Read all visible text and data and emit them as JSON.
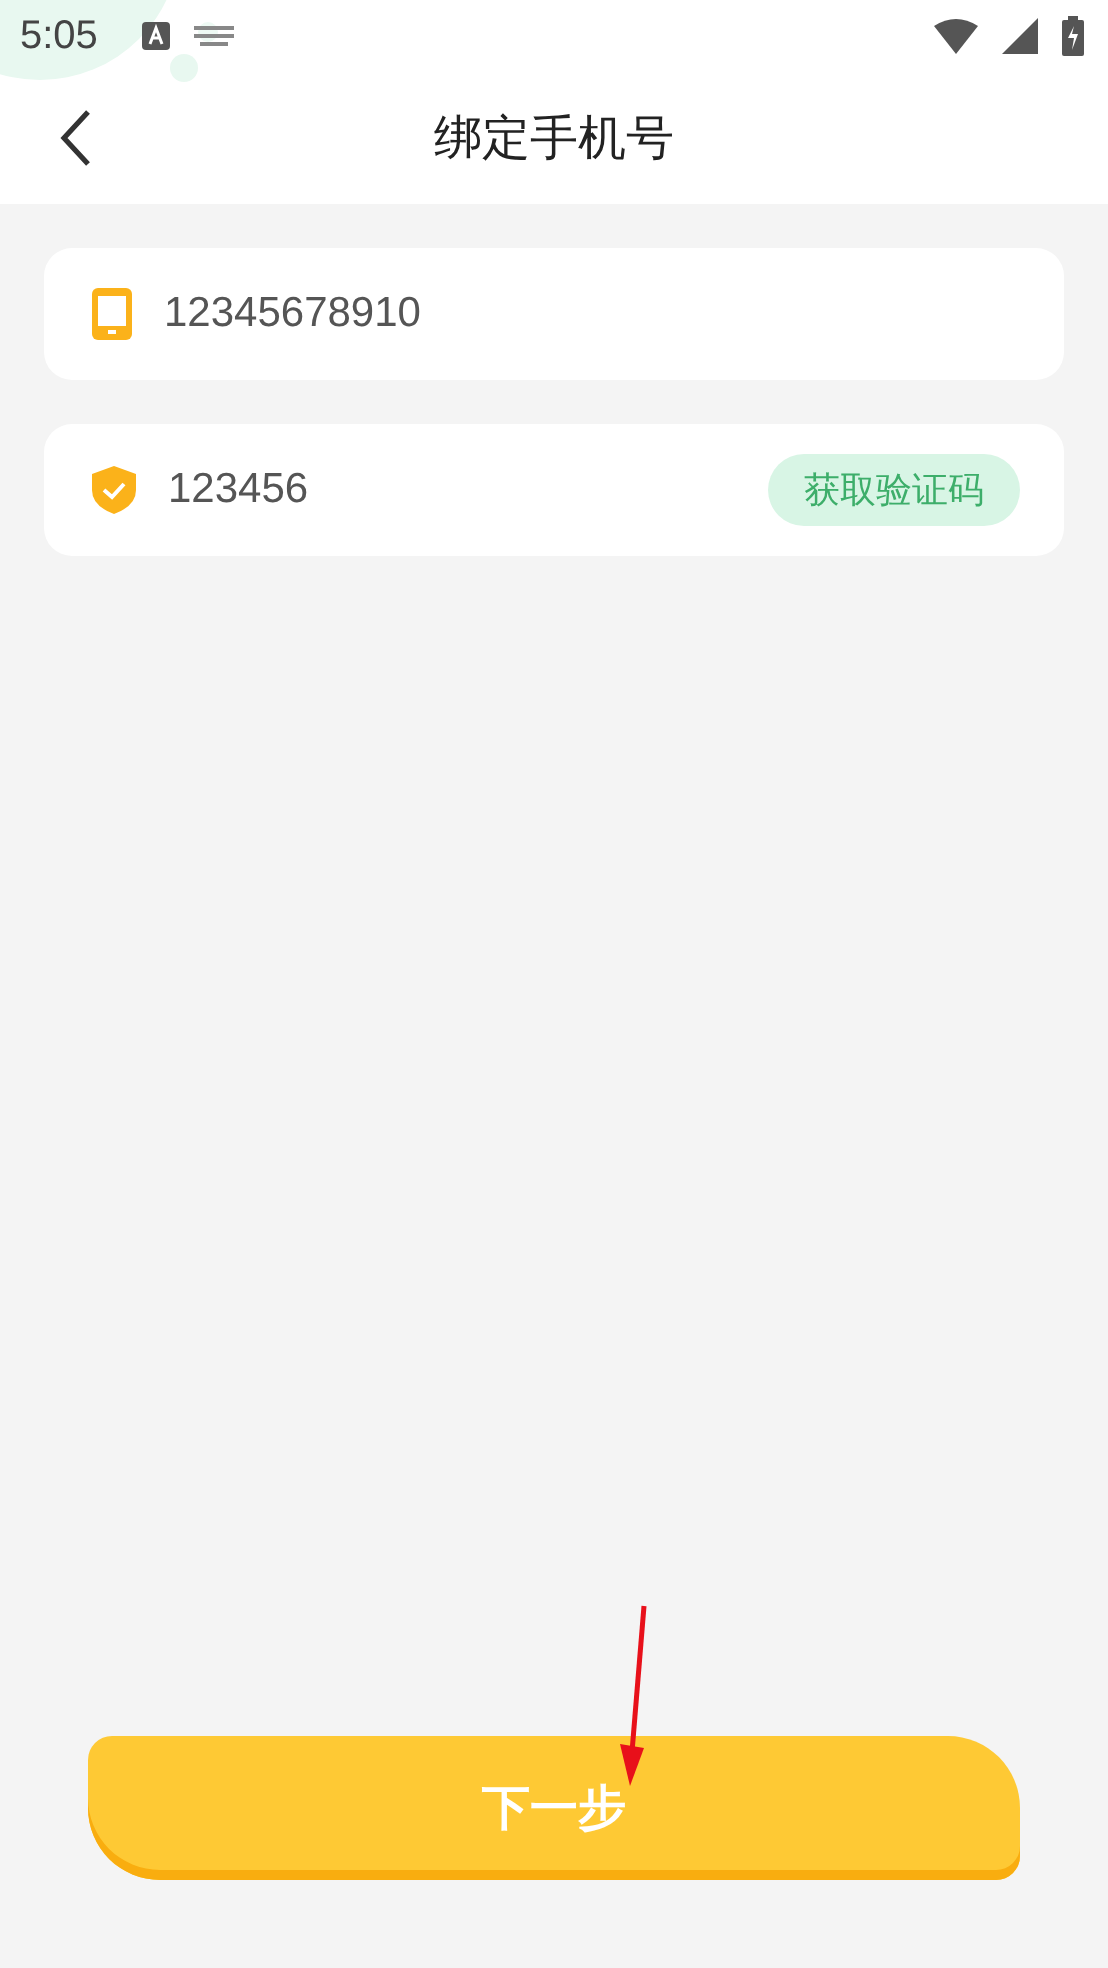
{
  "status_bar": {
    "time": "5:05"
  },
  "header": {
    "title": "绑定手机号"
  },
  "fields": [
    {
      "kind": "phone",
      "value": "12345678910"
    },
    {
      "kind": "code",
      "value": "123456",
      "action": "获取验证码"
    }
  ],
  "next_button": {
    "label": "下一步"
  }
}
